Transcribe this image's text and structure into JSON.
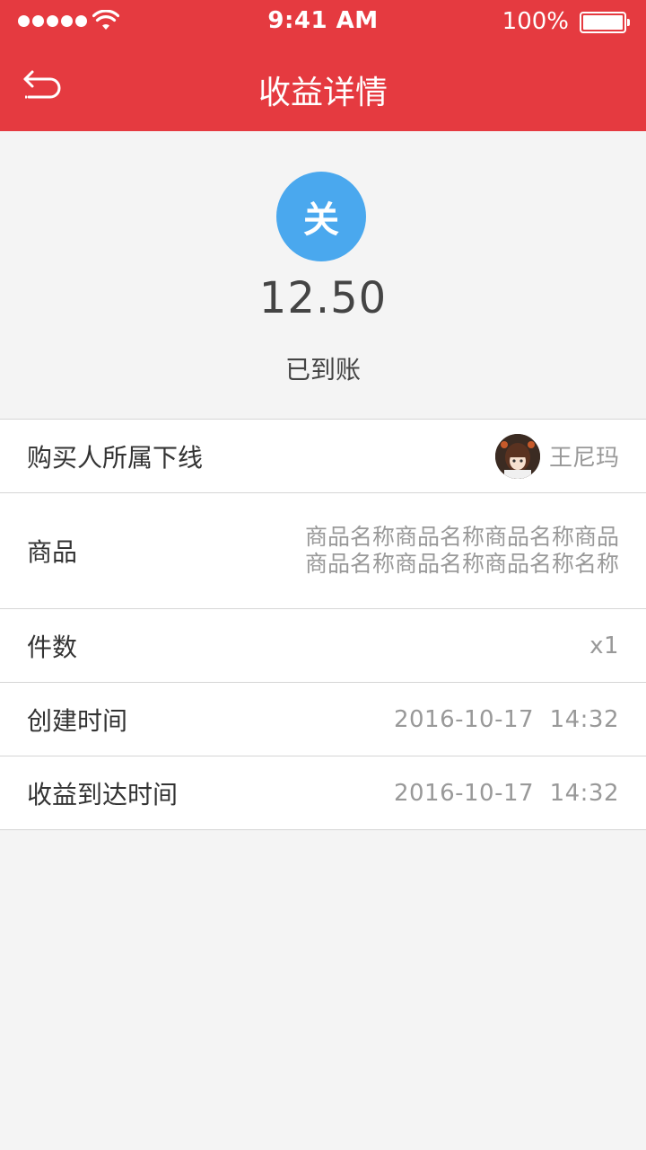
{
  "status_bar": {
    "time": "9:41 AM",
    "battery_percent": "100%",
    "battery_level": 1.0,
    "signal_bars": 5,
    "icons": [
      "signal-icon",
      "wifi-icon",
      "battery-icon"
    ]
  },
  "nav": {
    "title": "收益详情",
    "back_icon": "back-arrow-icon"
  },
  "summary": {
    "avatar_char": "关",
    "avatar_color": "#4aa8ee",
    "amount": "12.50",
    "status": "已到账"
  },
  "details": {
    "buyer": {
      "label": "购买人所属下线",
      "name": "王尼玛"
    },
    "product": {
      "label": "商品",
      "value": "商品名称商品名称商品名称商品商品名称商品名称商品名称名称"
    },
    "quantity": {
      "label": "件数",
      "value": "x1"
    },
    "created": {
      "label": "创建时间",
      "value": "2016-10-17  14:32"
    },
    "arrived": {
      "label": "收益到达时间",
      "value": "2016-10-17  14:32"
    }
  },
  "colors": {
    "header": "#e53a40",
    "background": "#f4f4f4",
    "accent_blue": "#4aa8ee"
  }
}
